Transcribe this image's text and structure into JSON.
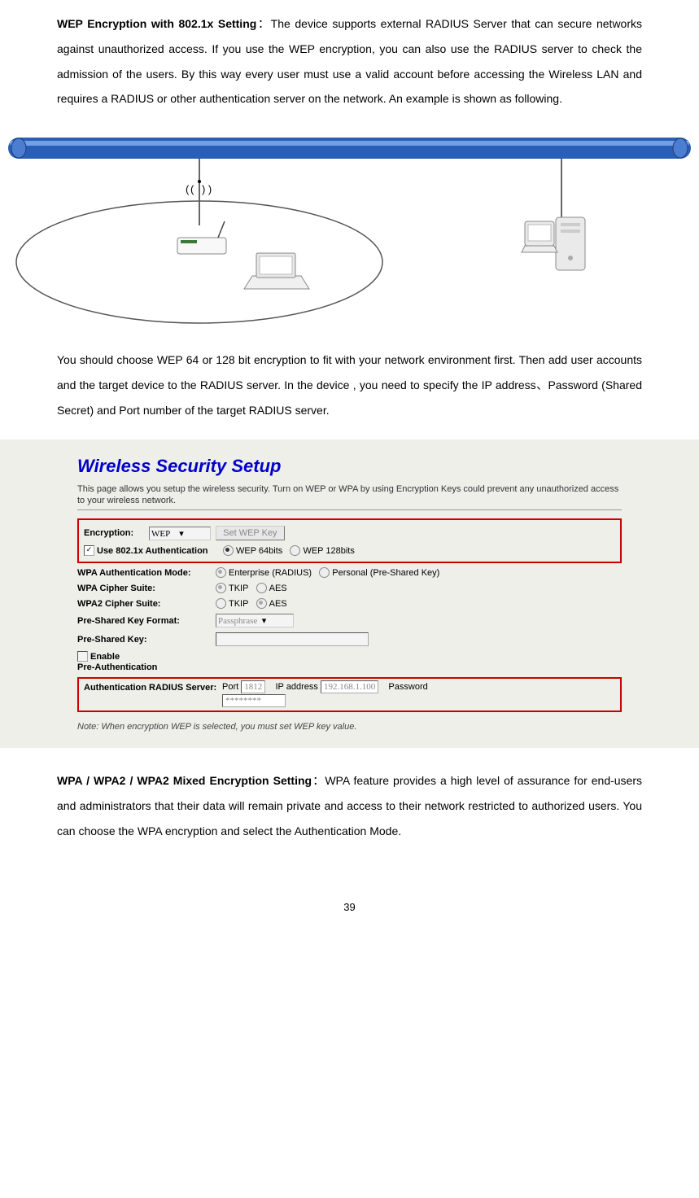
{
  "para1": {
    "bold": "WEP Encryption with 802.1x Setting",
    "sep": "：",
    "text": "The device supports external RADIUS Server that can secure networks against unauthorized access. If you use the WEP encryption, you can also use the RADIUS server to check the admission of the users. By this way every user must use a valid account before accessing the Wireless LAN and requires a RADIUS or other authentication server on the network. An example is shown as following."
  },
  "para2": "You should choose WEP 64 or 128 bit encryption to fit with your network environment first. Then add user accounts and the target device to the RADIUS server. In the device , you need to specify the IP address、Password (Shared Secret) and Port number of the target RADIUS server.",
  "panel": {
    "title": "Wireless Security Setup",
    "desc": "This page allows you setup the wireless security. Turn on WEP or WPA by using Encryption Keys could prevent any unauthorized access to your wireless network.",
    "encryption_label": "Encryption:",
    "encryption_value": "WEP",
    "set_wep_btn": "Set WEP Key",
    "use_8021x_label": "Use 802.1x Authentication",
    "wep64": "WEP 64bits",
    "wep128": "WEP 128bits",
    "wpa_auth_label": "WPA Authentication Mode:",
    "wpa_auth_opt1": "Enterprise (RADIUS)",
    "wpa_auth_opt2": "Personal (Pre-Shared Key)",
    "wpa_cipher_label": "WPA Cipher Suite:",
    "tkip": "TKIP",
    "aes": "AES",
    "wpa2_cipher_label": "WPA2 Cipher Suite:",
    "psk_format_label": "Pre-Shared Key Format:",
    "psk_format_value": "Passphrase",
    "psk_label": "Pre-Shared Key:",
    "enable_preauth_line1": "Enable",
    "enable_preauth_line2": "Pre-Authentication",
    "radius_label": "Authentication RADIUS Server:",
    "port_label": "Port",
    "port_value": "1812",
    "ip_label": "IP address",
    "ip_value": "192.168.1.100",
    "password_label": "Password",
    "password_value": "********",
    "note": "Note: When encryption WEP is selected, you must set WEP key value."
  },
  "para3": {
    "bold": "WPA / WPA2 / WPA2 Mixed Encryption Setting",
    "sep": "：",
    "text": "WPA feature provides a high level of assurance for end-users and administrators that their data will remain private and access to their network restricted to authorized users. You can choose the WPA encryption and select the Authentication Mode."
  },
  "page_number": "39"
}
